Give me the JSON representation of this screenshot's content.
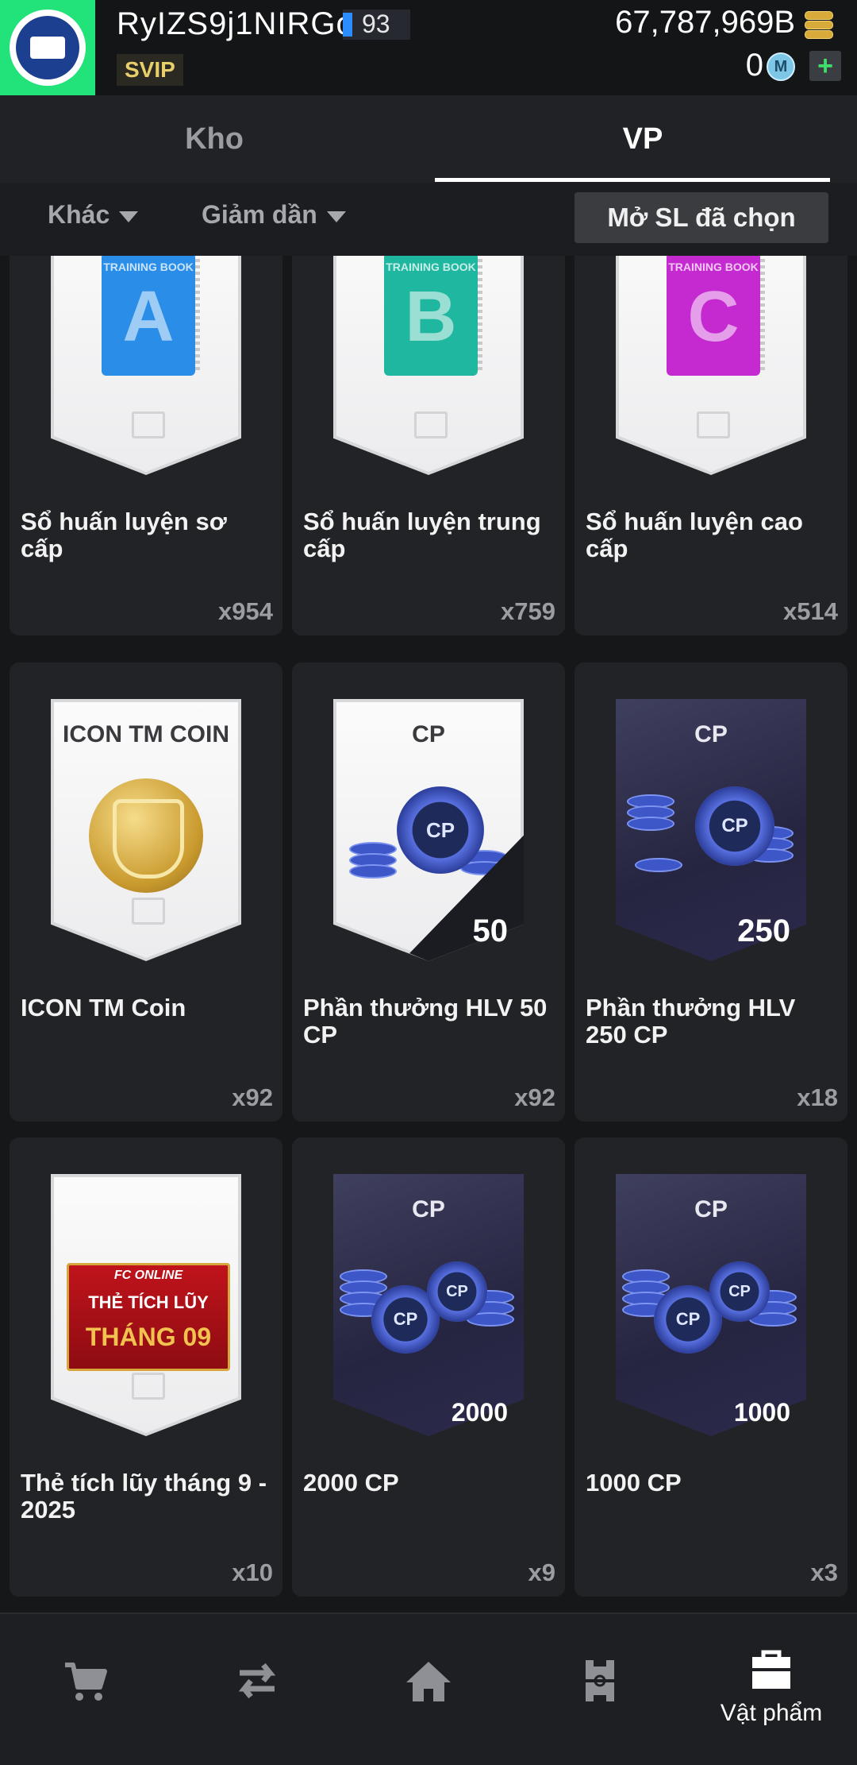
{
  "header": {
    "username": "RyIZS9j1NIRGo",
    "level": "93",
    "vip": "SVIP",
    "coins": "67,787,969B",
    "mcoin": "0",
    "mcoin_icon": "M",
    "plus_label": "+"
  },
  "tabs": [
    {
      "label": "Kho",
      "active": false
    },
    {
      "label": "VP",
      "active": true
    }
  ],
  "filters": {
    "category": "Khác",
    "sort": "Giảm dần",
    "open_selected": "Mở SL đã chọn"
  },
  "items": [
    {
      "name": "Sổ huấn luyện sơ cấp",
      "qty": "x954",
      "card": {
        "style": "white",
        "book_color": "#2a8ee8",
        "book_letter": "A",
        "book_tag": "TRAINING BOOK"
      }
    },
    {
      "name": "Sổ huấn luyện trung cấp",
      "qty": "x759",
      "card": {
        "style": "white",
        "book_color": "#1fb7a0",
        "book_letter": "B",
        "book_tag": "TRAINING BOOK"
      }
    },
    {
      "name": "Sổ huấn luyện cao cấp",
      "qty": "x514",
      "card": {
        "style": "white",
        "book_color": "#c52ad0",
        "book_letter": "C",
        "book_tag": "TRAINING BOOK"
      }
    },
    {
      "name": "ICON TM Coin",
      "qty": "x92",
      "card": {
        "style": "white",
        "label": "ICON TM COIN"
      }
    },
    {
      "name": "Phần thưởng HLV 50 CP",
      "qty": "x92",
      "card": {
        "style": "white",
        "label": "CP",
        "amount": "50"
      }
    },
    {
      "name": "Phần thưởng HLV 250 CP",
      "qty": "x18",
      "card": {
        "style": "dark",
        "label": "CP",
        "amount": "250"
      }
    },
    {
      "name": "Thẻ tích lũy tháng 9 - 2025",
      "qty": "x10",
      "card": {
        "style": "white",
        "banner": [
          "FC ONLINE",
          "THẺ TÍCH LŨY",
          "THÁNG 09"
        ]
      }
    },
    {
      "name": "2000 CP",
      "qty": "x9",
      "card": {
        "style": "dark",
        "label": "CP",
        "amount": "2000"
      }
    },
    {
      "name": "1000 CP",
      "qty": "x3",
      "card": {
        "style": "dark",
        "label": "CP",
        "amount": "1000"
      }
    }
  ],
  "cp_coin_label": "CP",
  "bottom_nav": [
    {
      "icon": "cart-icon",
      "label": ""
    },
    {
      "icon": "transfer-icon",
      "label": ""
    },
    {
      "icon": "home-icon",
      "label": ""
    },
    {
      "icon": "field-icon",
      "label": ""
    },
    {
      "icon": "bag-icon",
      "label": "Vật phẩm"
    }
  ]
}
